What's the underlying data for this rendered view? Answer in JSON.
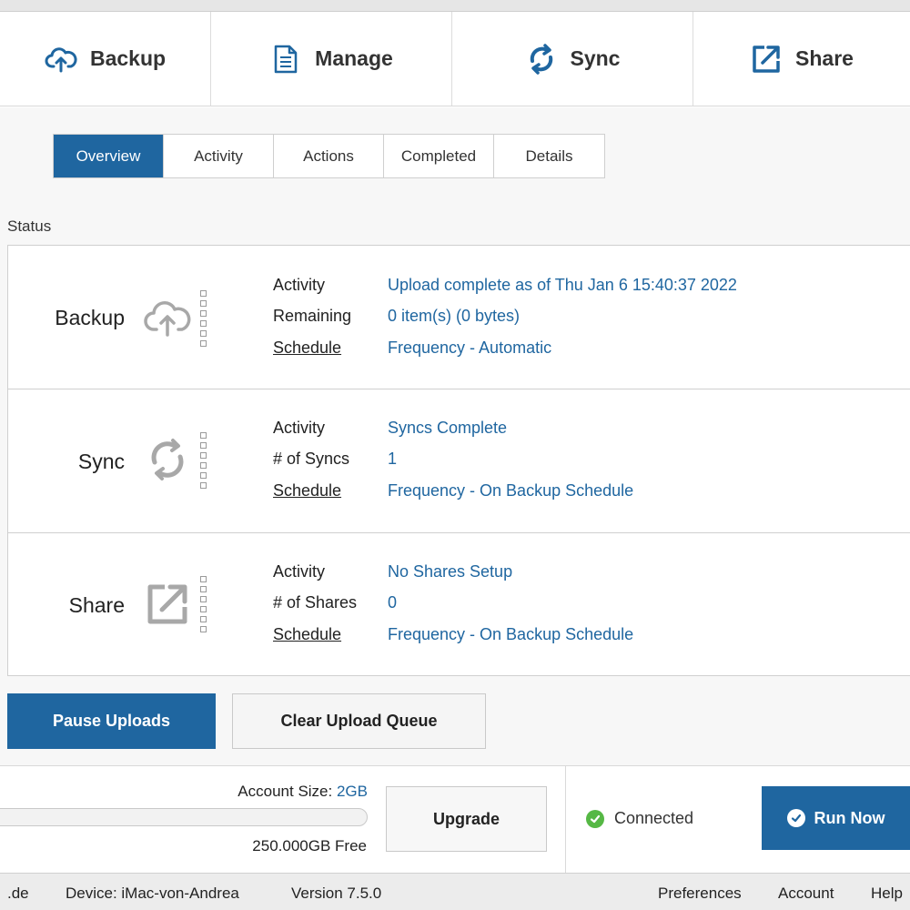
{
  "nav": {
    "backup": "Backup",
    "manage": "Manage",
    "sync": "Sync",
    "share": "Share"
  },
  "tabs": {
    "overview": "Overview",
    "activity": "Activity",
    "actions": "Actions",
    "completed": "Completed",
    "details": "Details",
    "active": "Overview"
  },
  "status": {
    "title": "Status",
    "backup": {
      "name": "Backup",
      "labels": {
        "activity": "Activity",
        "second": "Remaining",
        "schedule": "Schedule"
      },
      "values": {
        "activity": "Upload complete as of Thu Jan  6 15:40:37 2022",
        "second": "0 item(s) (0 bytes)",
        "schedule": "Frequency - Automatic"
      }
    },
    "sync": {
      "name": "Sync",
      "labels": {
        "activity": "Activity",
        "second": "# of Syncs",
        "schedule": "Schedule"
      },
      "values": {
        "activity": "Syncs Complete",
        "second": "1",
        "schedule": "Frequency - On Backup Schedule"
      }
    },
    "share": {
      "name": "Share",
      "labels": {
        "activity": "Activity",
        "second": "# of Shares",
        "schedule": "Schedule"
      },
      "values": {
        "activity": "No Shares Setup",
        "second": "0",
        "schedule": "Frequency - On Backup Schedule"
      }
    }
  },
  "buttons": {
    "pause": "Pause Uploads",
    "clear": "Clear Upload Queue",
    "upgrade": "Upgrade",
    "run_now": "Run Now"
  },
  "account": {
    "size_label": "Account Size: ",
    "size_value": "2GB",
    "free": "250.000GB Free",
    "usage_fraction": 0.0,
    "connection": "Connected"
  },
  "footer": {
    "domain": ".de",
    "device": "Device: iMac-von-Andrea",
    "version": "Version 7.5.0",
    "preferences": "Preferences",
    "account": "Account",
    "help": "Help"
  },
  "colors": {
    "accent": "#1f66a0",
    "connected": "#56b845",
    "status_icon": "#a8a8a8"
  },
  "icons": {
    "backup": "cloud-upload-icon",
    "manage": "document-icon",
    "sync": "sync-arrows-icon",
    "share": "external-link-icon",
    "connected": "check-circle-icon",
    "run_now": "check-circle-icon"
  }
}
